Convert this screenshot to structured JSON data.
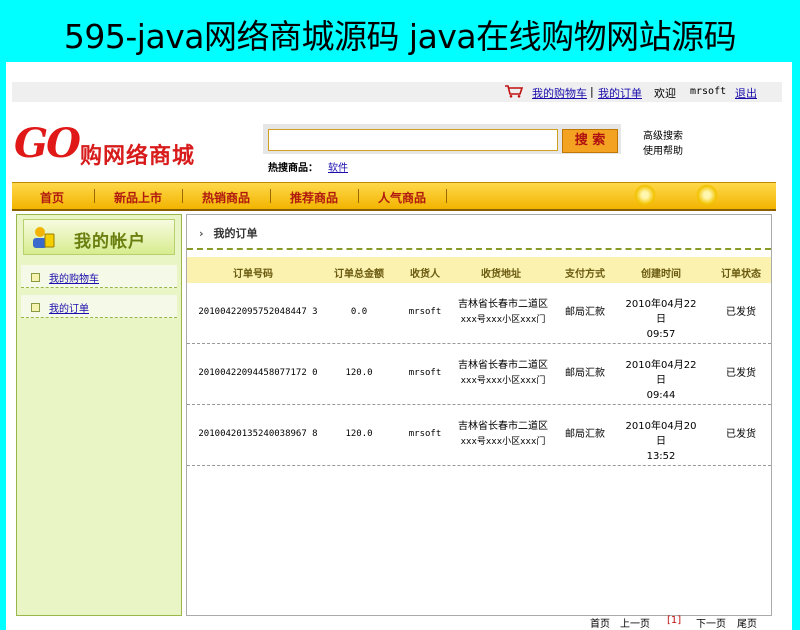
{
  "banner": {
    "title": "595-java网络商城源码 java在线购物网站源码"
  },
  "topbar": {
    "cart_link": "我的购物车",
    "separator": "|",
    "orders_link": "我的订单",
    "welcome": "欢迎",
    "username": "mrsoft",
    "logout": "退出"
  },
  "logo": {
    "mark": "GO",
    "text": "购网络商城"
  },
  "search": {
    "value": "",
    "button_label": "搜 索",
    "advanced": "高级搜索",
    "help": "使用帮助",
    "hot_label": "热搜商品：",
    "hot_item": "软件"
  },
  "nav": {
    "items": [
      "首页",
      "新品上市",
      "热销商品",
      "推荐商品",
      "人气商品"
    ]
  },
  "sidebar": {
    "title": "我的帐户",
    "items": [
      {
        "label": "我的购物车"
      },
      {
        "label": "我的订单"
      }
    ]
  },
  "main": {
    "title": "我的订单",
    "columns": [
      "订单号码",
      "订单总金额",
      "收货人",
      "收货地址",
      "支付方式",
      "创建时间",
      "订单状态"
    ],
    "orders": [
      {
        "id": "20100422095752048447 3",
        "amount": "0.0",
        "receiver": "mrsoft",
        "address_1": "吉林省长春市二道区",
        "address_2": "xxx号xxx小区xxx门",
        "payment": "邮局汇款",
        "date": "2010年04月22日",
        "time": "09:57",
        "status": "已发货"
      },
      {
        "id": "20100422094458077172 0",
        "amount": "120.0",
        "receiver": "mrsoft",
        "address_1": "吉林省长春市二道区",
        "address_2": "xxx号xxx小区xxx门",
        "payment": "邮局汇款",
        "date": "2010年04月22日",
        "time": "09:44",
        "status": "已发货"
      },
      {
        "id": "20100420135240038967 8",
        "amount": "120.0",
        "receiver": "mrsoft",
        "address_1": "吉林省长春市二道区",
        "address_2": "xxx号xxx小区xxx门",
        "payment": "邮局汇款",
        "date": "2010年04月20日",
        "time": "13:52",
        "status": "已发货"
      }
    ]
  },
  "pager": {
    "first": "首页",
    "prev": "上一页",
    "current": "[1]",
    "next": "下一页",
    "last": "尾页"
  }
}
